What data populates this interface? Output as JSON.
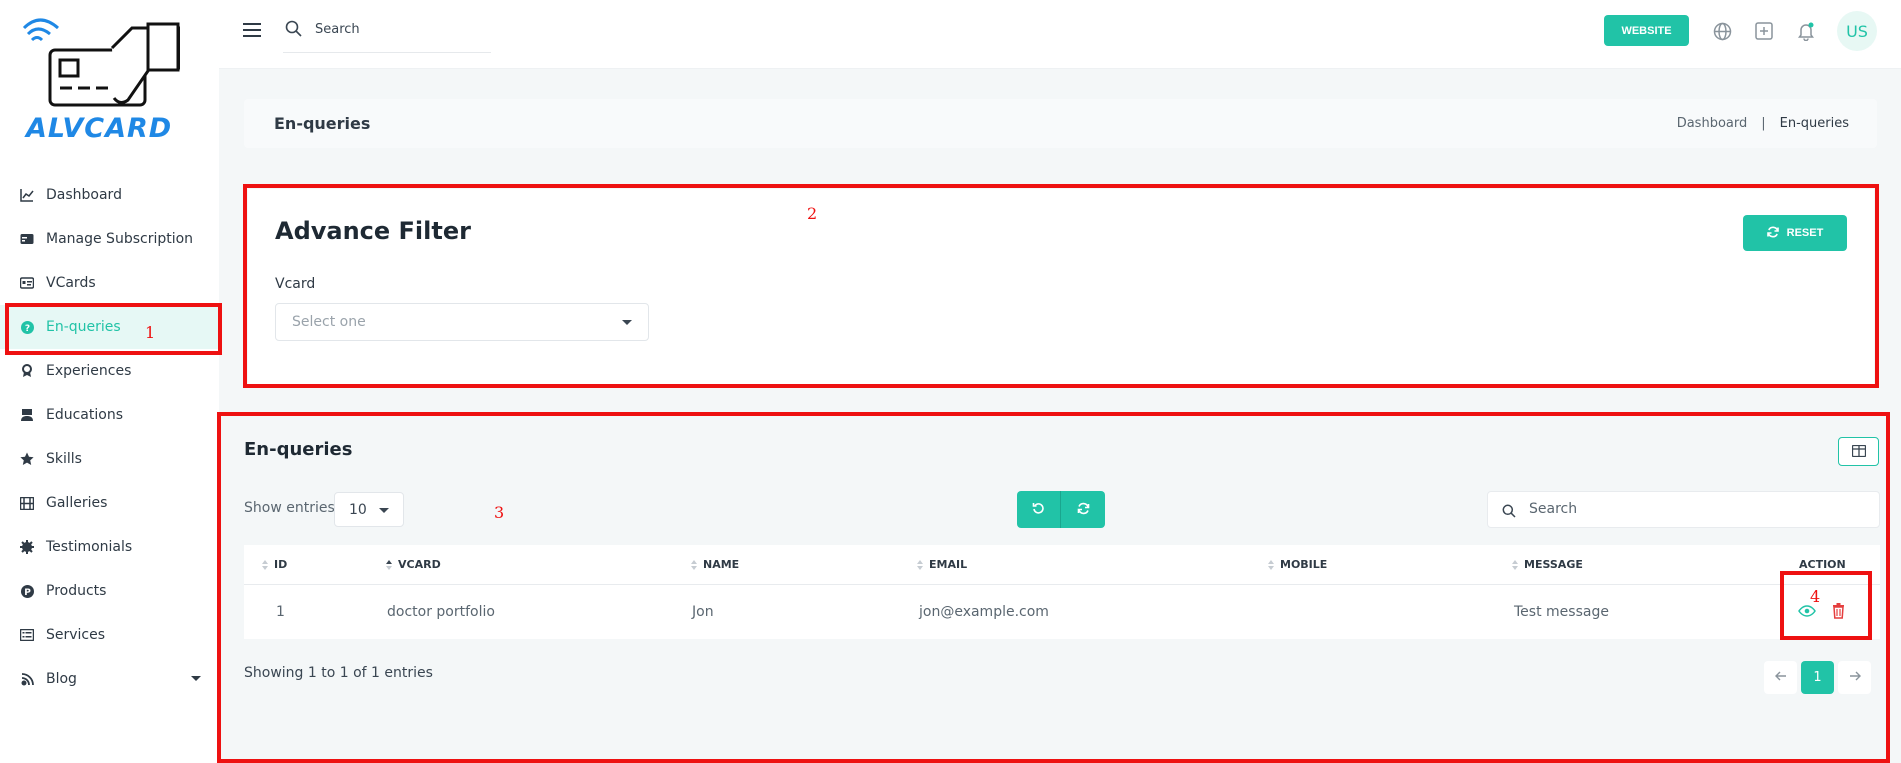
{
  "brand": {
    "logo_text": "ALVCARD",
    "accent": "#21c3a7",
    "logo_color": "#1f88e5"
  },
  "sidebar": {
    "items": [
      {
        "label": "Dashboard",
        "icon": "chart-line-icon",
        "active": false
      },
      {
        "label": "Manage Subscription",
        "icon": "credit-card-icon",
        "active": false
      },
      {
        "label": "VCards",
        "icon": "id-card-icon",
        "active": false
      },
      {
        "label": "En-queries",
        "icon": "question-circle-icon",
        "active": true
      },
      {
        "label": "Experiences",
        "icon": "award-icon",
        "active": false
      },
      {
        "label": "Educations",
        "icon": "graduate-icon",
        "active": false
      },
      {
        "label": "Skills",
        "icon": "star-icon",
        "active": false
      },
      {
        "label": "Galleries",
        "icon": "film-icon",
        "active": false
      },
      {
        "label": "Testimonials",
        "icon": "certificate-icon",
        "active": false
      },
      {
        "label": "Products",
        "icon": "product-p-icon",
        "active": false
      },
      {
        "label": "Services",
        "icon": "list-icon",
        "active": false
      },
      {
        "label": "Blog",
        "icon": "blog-icon",
        "active": false,
        "has_submenu": true
      }
    ]
  },
  "header": {
    "search_placeholder": "Search",
    "website_label": "WEBSITE",
    "avatar_initials": "US"
  },
  "page": {
    "title": "En-queries",
    "breadcrumb": [
      "Dashboard",
      "En-queries"
    ]
  },
  "filter": {
    "title": "Advance Filter",
    "vcard_label": "Vcard",
    "vcard_placeholder": "Select one",
    "reset_label": "RESET"
  },
  "table_section": {
    "title": "En-queries",
    "show_entries_label": "Show entries",
    "entries_value": "10",
    "search_placeholder": "Search",
    "columns": [
      "ID",
      "VCARD",
      "NAME",
      "EMAIL",
      "MOBILE",
      "MESSAGE",
      "ACTION"
    ],
    "rows": [
      {
        "id": "1",
        "vcard": "doctor portfolio",
        "name": "Jon",
        "email": "jon@example.com",
        "mobile": "",
        "message": "Test message"
      }
    ],
    "showing_text": "Showing 1 to 1 of 1 entries",
    "pages": [
      "1"
    ]
  },
  "annotations": [
    "1",
    "2",
    "3",
    "4"
  ]
}
